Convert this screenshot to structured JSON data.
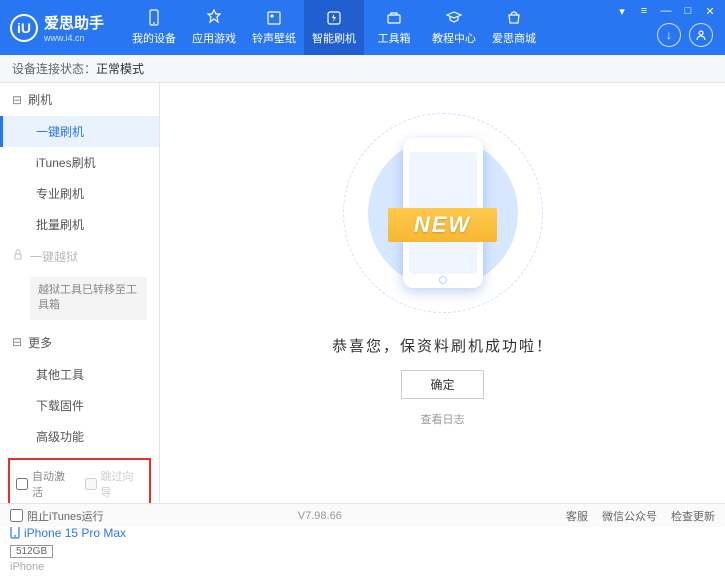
{
  "brand": {
    "title": "爱思助手",
    "url": "www.i4.cn",
    "logo_char": "iU"
  },
  "nav": [
    {
      "label": "我的设备"
    },
    {
      "label": "应用游戏"
    },
    {
      "label": "铃声壁纸"
    },
    {
      "label": "智能刷机"
    },
    {
      "label": "工具箱"
    },
    {
      "label": "教程中心"
    },
    {
      "label": "爱思商城"
    }
  ],
  "status": {
    "label": "设备连接状态：",
    "value": "正常模式"
  },
  "sidebar": {
    "flash_header": "刷机",
    "flash_items": [
      "一键刷机",
      "iTunes刷机",
      "专业刷机",
      "批量刷机"
    ],
    "jailbreak_header": "一键越狱",
    "jailbreak_msg": "越狱工具已转移至工具箱",
    "more_header": "更多",
    "more_items": [
      "其他工具",
      "下载固件",
      "高级功能"
    ]
  },
  "options": {
    "auto_activate": "自动激活",
    "skip_guide": "跳过向导"
  },
  "device": {
    "name": "iPhone 15 Pro Max",
    "storage": "512GB",
    "type": "iPhone"
  },
  "content": {
    "ribbon": "NEW",
    "success": "恭喜您，保资料刷机成功啦！",
    "confirm": "确定",
    "log_link": "查看日志"
  },
  "footer": {
    "block_itunes": "阻止iTunes运行",
    "version": "V7.98.66",
    "links": [
      "客服",
      "微信公众号",
      "检查更新"
    ]
  }
}
